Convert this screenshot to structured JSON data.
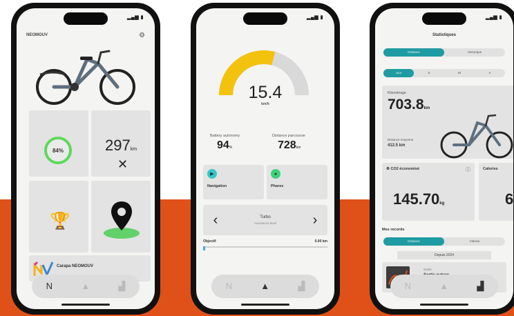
{
  "colors": {
    "background_band": "#e0511a",
    "accent_green": "#5ed85b",
    "gauge_yellow": "#f3c20e",
    "teal": "#1f9ba3"
  },
  "phone1": {
    "battery_ring_text": "84%",
    "km_value": "297",
    "km_unit": "km",
    "brand_label": "NEOMOUV",
    "brand_name": "Carapa NEOMOUV",
    "tabs": [
      {
        "label": "Home",
        "icon": "nv-logo-icon"
      },
      {
        "label": "Bike",
        "icon": "bike-icon"
      },
      {
        "label": "Stats",
        "icon": "stats-icon"
      }
    ]
  },
  "phone2": {
    "speed_value": "15.4",
    "speed_unit": "km/h",
    "gauge_level_percent": 58,
    "left_stat_label": "Battery autonomy",
    "left_stat_value": "94",
    "left_stat_unit": "%",
    "right_stat_label": "Distance parcourue",
    "right_stat_value": "728",
    "right_stat_unit": "km",
    "cards": [
      {
        "label": "Navigation",
        "icon": "navigation-icon"
      },
      {
        "label": "Phares",
        "icon": "light-icon"
      }
    ],
    "mode_label": "Turbo",
    "mode_sub": "Assistance level",
    "trip_left": "Objectif",
    "trip_right": "0.00 km",
    "tabs": [
      {
        "label": "Home",
        "icon": "nv-logo-icon"
      },
      {
        "label": "Bike",
        "icon": "bike-icon"
      },
      {
        "label": "Stats",
        "icon": "stats-icon"
      }
    ]
  },
  "phone3": {
    "title": "Statistiques",
    "segments_top": [
      "Distance",
      "Historique"
    ],
    "segments_period": [
      "Jour",
      "S",
      "M",
      "A"
    ],
    "odo_label": "Kilométrage",
    "odo_value": "703.8",
    "odo_unit": "km",
    "sub_label": "Distance moyenne",
    "sub_value": "412.5 km",
    "co2_head": "CO2 économisé",
    "co2_value": "145.70",
    "co2_unit": "kg",
    "peek_head": "Calories",
    "peek_value": "6",
    "records_title": "Mes records",
    "record_segments": [
      "Distance",
      "Vitesse"
    ],
    "record_banner": "Depuis 2024",
    "record_label": "Sortie",
    "record_name": "Sortie nature",
    "tabs": [
      {
        "label": "Home",
        "icon": "nv-logo-icon"
      },
      {
        "label": "Bike",
        "icon": "bike-icon"
      },
      {
        "label": "Stats",
        "icon": "stats-icon"
      }
    ]
  }
}
